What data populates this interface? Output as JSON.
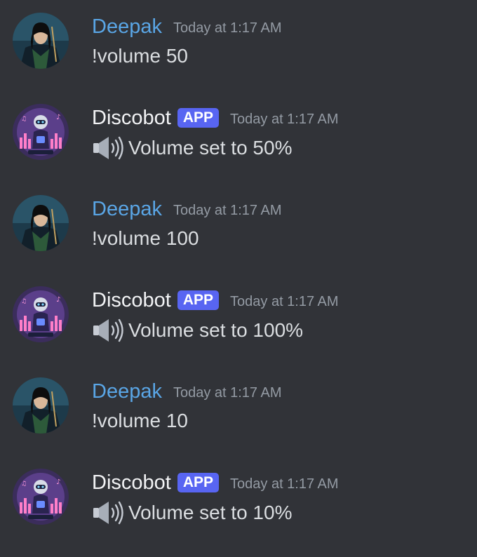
{
  "messages": [
    {
      "author": "Deepak",
      "type": "user",
      "timestamp": "Today at 1:17 AM",
      "text": "!volume 50"
    },
    {
      "author": "Discobot",
      "type": "bot",
      "badge": "APP",
      "timestamp": "Today at 1:17 AM",
      "icon": "speaker-icon",
      "text": "Volume set to 50%"
    },
    {
      "author": "Deepak",
      "type": "user",
      "timestamp": "Today at 1:17 AM",
      "text": "!volume 100"
    },
    {
      "author": "Discobot",
      "type": "bot",
      "badge": "APP",
      "timestamp": "Today at 1:17 AM",
      "icon": "speaker-icon",
      "text": "Volume set to 100%"
    },
    {
      "author": "Deepak",
      "type": "user",
      "timestamp": "Today at 1:17 AM",
      "text": "!volume 10"
    },
    {
      "author": "Discobot",
      "type": "bot",
      "badge": "APP",
      "timestamp": "Today at 1:17 AM",
      "icon": "speaker-icon",
      "text": "Volume set to 10%"
    }
  ],
  "colors": {
    "background": "#313338",
    "user_name": "#5aa6e6",
    "bot_name": "#f2f3f5",
    "app_badge": "#5865f2",
    "timestamp": "#949ba4",
    "message_text": "#dbdee1"
  }
}
